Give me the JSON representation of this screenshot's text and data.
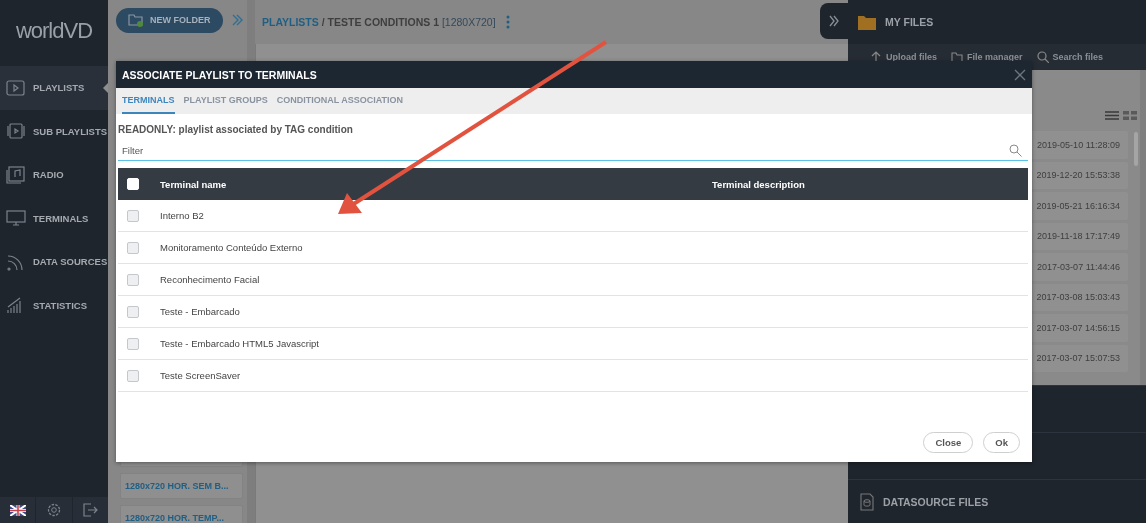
{
  "sidebar": {
    "logo": "worldVD",
    "items": [
      {
        "label": "PLAYLISTS",
        "kind": "playlists",
        "selected": true
      },
      {
        "label": "SUB PLAYLISTS",
        "kind": "subplaylists",
        "selected": false
      },
      {
        "label": "RADIO",
        "kind": "radio",
        "selected": false
      },
      {
        "label": "TERMINALS",
        "kind": "terminals",
        "selected": false
      },
      {
        "label": "DATA SOURCES",
        "kind": "datasources",
        "selected": false
      },
      {
        "label": "STATISTICS",
        "kind": "statistics",
        "selected": false
      }
    ]
  },
  "playlist_column": {
    "new_folder_button": "NEW FOLDER",
    "items": [
      "1280x720 HOR. SEM B...",
      "1280x720 HOR. TEMP..."
    ]
  },
  "breadcrumb": {
    "root": "PLAYLISTS",
    "separator": "/",
    "current": "TESTE CONDITIONS 1",
    "resolution": "[1280X720]"
  },
  "files_panel": {
    "title": "MY FILES",
    "toolbar": [
      "Upload files",
      "File manager",
      "Search files"
    ],
    "dates": [
      "2019-05-10 11:28:09",
      "2019-12-20 15:53:38",
      "2019-05-21 16:16:34",
      "2019-11-18 17:17:49",
      "2017-03-07 11:44:46",
      "2017-03-08 15:03:43",
      "2017-03-07 14:56:15",
      "2017-03-07 15:07:53"
    ],
    "datasource_title": "DATASOURCE FILES"
  },
  "dialog": {
    "title": "ASSOCIATE PLAYLIST TO TERMINALS",
    "tabs": [
      {
        "label": "TERMINALS",
        "selected": true
      },
      {
        "label": "PLAYLIST GROUPS",
        "selected": false
      },
      {
        "label": "CONDITIONAL ASSOCIATION",
        "selected": false
      }
    ],
    "note": "READONLY: playlist associated by TAG condition",
    "filter": {
      "placeholder": "Filter"
    },
    "table": {
      "columns": [
        "Terminal name",
        "Terminal description"
      ],
      "all_checked": false,
      "rows": [
        {
          "name": "Interno B2",
          "checked": false
        },
        {
          "name": "Monitoramento Conteúdo Externo",
          "checked": false
        },
        {
          "name": "Reconhecimento Facial",
          "checked": false
        },
        {
          "name": "Teste - Embarcado",
          "checked": false
        },
        {
          "name": "Teste - Embarcado HTML5 Javascript",
          "checked": false
        },
        {
          "name": "Teste ScreenSaver",
          "checked": false
        }
      ]
    },
    "buttons": [
      "Close",
      "Ok"
    ]
  }
}
